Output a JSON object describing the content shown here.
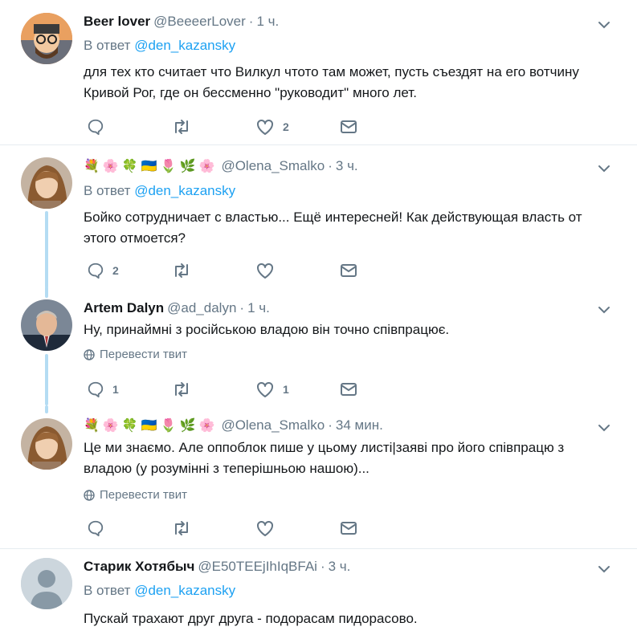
{
  "tweets": [
    {
      "name": "Beer lover",
      "handle": "@BeeeerLover",
      "time": "1 ч.",
      "reply_prefix": "В ответ",
      "reply_to": "@den_kazansky",
      "text_lines": [
        "для тех кто считает что Вилкул чтото там может, пусть съездят на его вотчину",
        "Кривой Рог, где он бессменно \"руководит\" много лет."
      ],
      "replies": "",
      "retweets": "",
      "likes": "2"
    },
    {
      "name": "",
      "emojis": [
        "💐",
        "🌸",
        "🍀",
        "🇺🇦",
        "🌷",
        "🌿",
        "🌸"
      ],
      "handle": "@Olena_Smalko",
      "time": "3 ч.",
      "reply_prefix": "В ответ",
      "reply_to": "@den_kazansky",
      "text_lines": [
        "Бойко сотрудничает с властью... Ещё интересней! Как действующая власть от",
        "этого отмоется?"
      ],
      "replies": "2",
      "retweets": "",
      "likes": ""
    },
    {
      "name": "Artem Dalyn",
      "handle": "@ad_dalyn",
      "time": "1 ч.",
      "text_lines": [
        "Ну, принаймні з російською владою він точно співпрацює."
      ],
      "translate": "Перевести твит",
      "replies": "1",
      "retweets": "",
      "likes": "1"
    },
    {
      "name": "",
      "emojis": [
        "💐",
        "🌸",
        "🍀",
        "🇺🇦",
        "🌷",
        "🌿",
        "🌸"
      ],
      "handle": "@Olena_Smalko",
      "time": "34 мин.",
      "text_lines": [
        "Це ми знаємо. Але оппоблок пише у цьому листі|заяві про його співпрацю з",
        "владою (у розумінні з теперішньою нашою)..."
      ],
      "translate": "Перевести твит",
      "replies": "",
      "retweets": "",
      "likes": ""
    },
    {
      "name": "Старик Хотябыч",
      "handle": "@E50TEEjIhIqBFAi",
      "time": "3 ч.",
      "reply_prefix": "В ответ",
      "reply_to": "@den_kazansky",
      "text_lines": [
        "Пускай трахают друг друга - подорасам пидорасово."
      ],
      "replies": "",
      "retweets": "",
      "likes": ""
    }
  ],
  "icons": {
    "reply": "reply-icon",
    "retweet": "retweet-icon",
    "like": "like-icon",
    "dm": "direct-message-icon",
    "more": "chevron-down-icon",
    "translate": "globe-icon"
  },
  "colors": {
    "text": "#14171a",
    "secondary": "#657786",
    "link": "#1da1f2",
    "thread_line": "#b4dcf3",
    "divider": "#e6ecf0"
  }
}
